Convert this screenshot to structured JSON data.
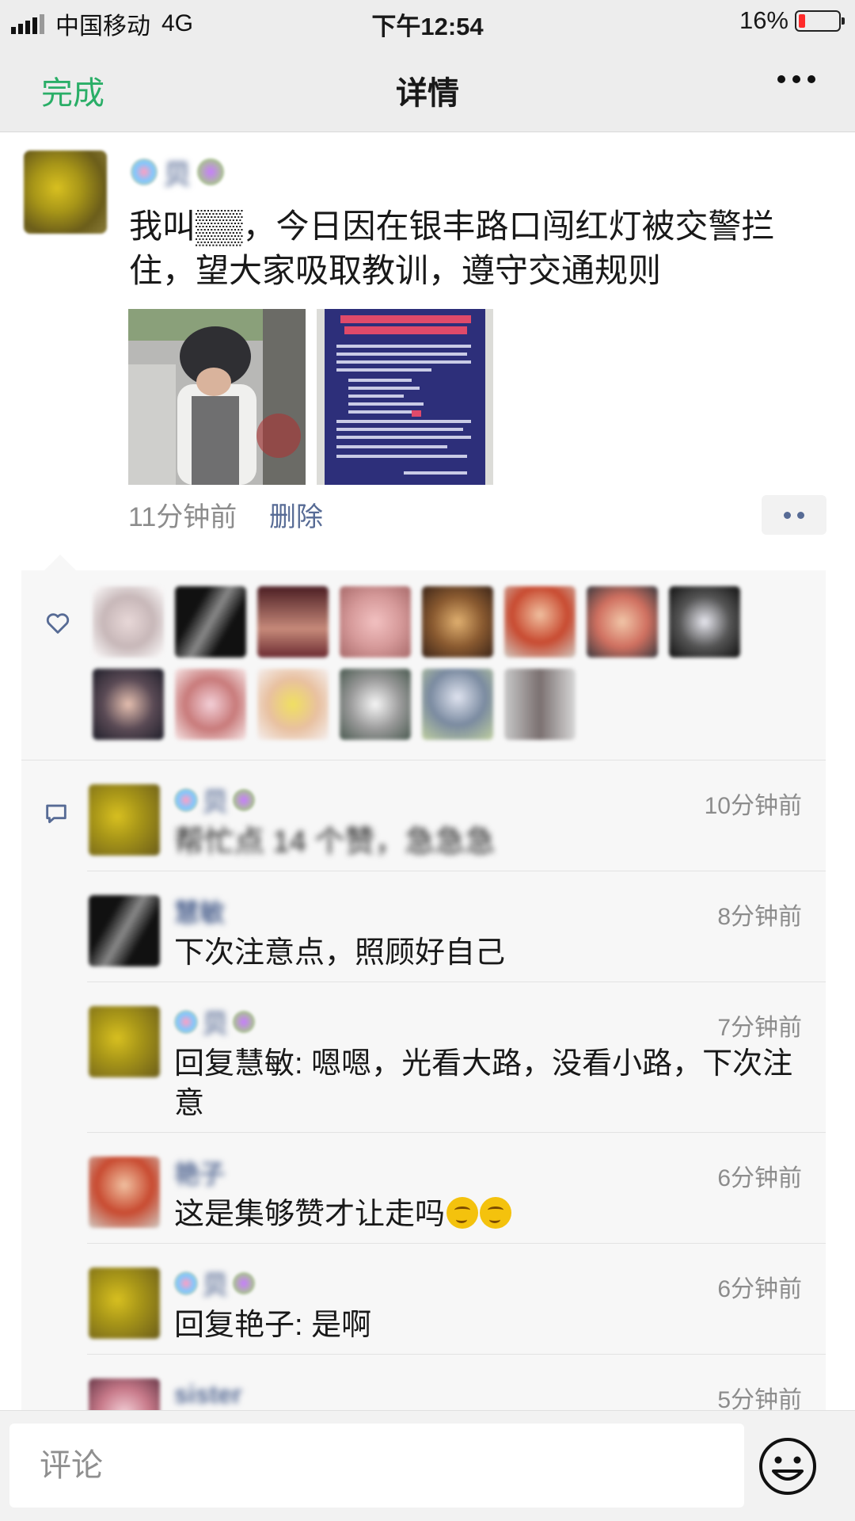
{
  "status_bar": {
    "carrier": "中国移动",
    "network": "4G",
    "time": "下午12:54",
    "battery_percent": "16%",
    "battery_level": 0.16,
    "battery_color": "#ff2a2a"
  },
  "nav": {
    "done_label": "完成",
    "title": "详情",
    "more_icon": "more-icon"
  },
  "post": {
    "author_name": "贝",
    "text": "我叫▒▒，今日因在银丰路口闯红灯被交警拦住，望大家吸取教训，遵守交通规则",
    "images": [
      "photo-person-on-street",
      "photo-notice-board"
    ],
    "time": "11分钟前",
    "delete_label": "删除"
  },
  "likes": {
    "icon": "heart-icon",
    "avatar_count": 14
  },
  "comments": {
    "icon": "comment-icon",
    "items": [
      {
        "name": "贝",
        "time": "10分钟前",
        "text": "帮忙点 14 个赞，急急急"
      },
      {
        "name": "慧敏",
        "time": "8分钟前",
        "text": "下次注意点，照顾好自己"
      },
      {
        "name": "贝",
        "time": "7分钟前",
        "text": "回复慧敏: 嗯嗯，光看大路，没看小路，下次注意"
      },
      {
        "name": "艳子",
        "time": "6分钟前",
        "text": "这是集够赞才让走吗"
      },
      {
        "name": "贝",
        "time": "6分钟前",
        "text": "回复艳子: 是啊"
      },
      {
        "name": "sister",
        "time": "5分钟前",
        "text": ""
      }
    ]
  },
  "input": {
    "placeholder": "评论",
    "emoji_icon": "smiley-icon"
  },
  "colors": {
    "accent_green": "#2aae67",
    "link_blue": "#576b95"
  }
}
